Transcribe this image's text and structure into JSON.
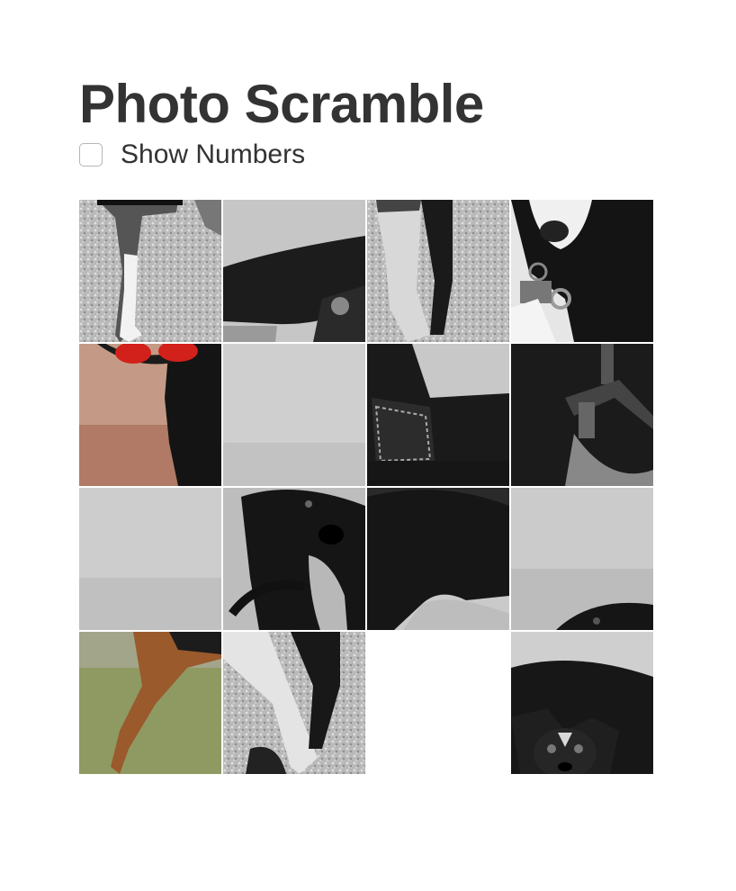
{
  "page": {
    "title": "Photo Scramble"
  },
  "options": {
    "show_numbers_label": "Show Numbers",
    "show_numbers_checked": false
  },
  "board": {
    "rows": 4,
    "cols": 4,
    "empty_slot": {
      "row": 3,
      "col": 2
    },
    "tiles": [
      {
        "content": "dog-legs-on-gravel"
      },
      {
        "content": "dog-belly-over-gray"
      },
      {
        "content": "crossed-legs-on-gravel"
      },
      {
        "content": "dog-face-with-collar-tags"
      },
      {
        "content": "red-harness-pink-background"
      },
      {
        "content": "blank-gray-background"
      },
      {
        "content": "dog-with-bandana"
      },
      {
        "content": "dog-chest-with-harness"
      },
      {
        "content": "gray-background"
      },
      {
        "content": "black-dog-tongue-out"
      },
      {
        "content": "dog-hindquarters"
      },
      {
        "content": "gray-background-dog-head-edge"
      },
      {
        "content": "brown-dog-leg-on-grass"
      },
      {
        "content": "dog-paws-on-gravel"
      },
      {
        "content": "black-dog-body-with-puppy-face"
      }
    ]
  }
}
